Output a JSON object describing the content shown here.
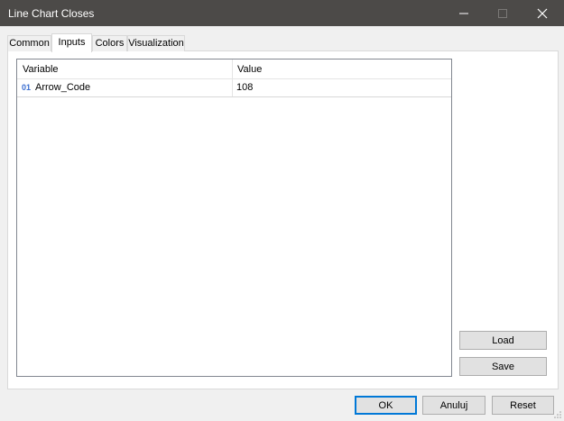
{
  "window": {
    "title": "Line Chart Closes"
  },
  "tabs": [
    {
      "label": "Common"
    },
    {
      "label": "Inputs"
    },
    {
      "label": "Colors"
    },
    {
      "label": "Visualization"
    }
  ],
  "active_tab": "Inputs",
  "grid": {
    "columns": [
      "Variable",
      "Value"
    ],
    "rows": [
      {
        "type_icon": "01",
        "variable": "Arrow_Code",
        "value": "108"
      }
    ]
  },
  "side_buttons": {
    "load": "Load",
    "save": "Save"
  },
  "footer_buttons": {
    "ok": "OK",
    "cancel": "Anuluj",
    "reset": "Reset"
  },
  "colors": {
    "titlebar": "#4c4a48",
    "accent": "#0078d7",
    "type_icon": "#3b6ed0"
  },
  "icons": {
    "minimize": "minimize-icon",
    "maximize": "maximize-icon",
    "close": "close-icon",
    "resize_grip": "resize-grip-icon"
  }
}
